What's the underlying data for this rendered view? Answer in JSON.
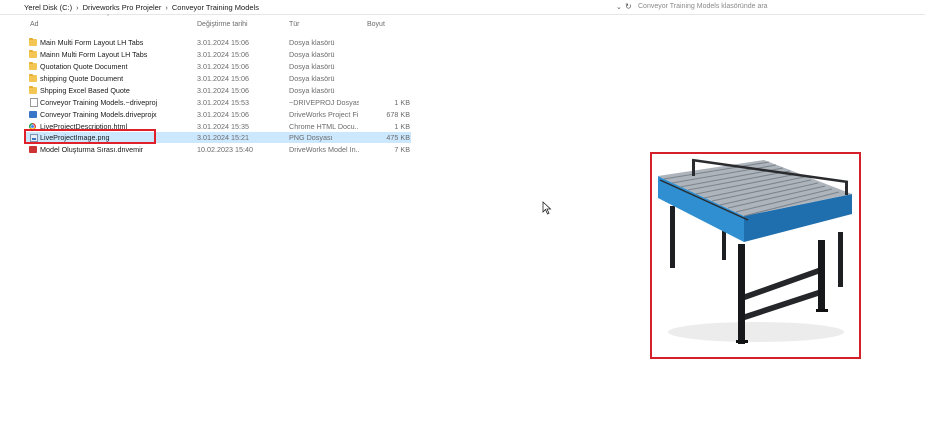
{
  "address_bar": {
    "breadcrumbs": [
      "Yerel Disk (C:)",
      "Driveworks Pro Projeler",
      "Conveyor Training Models"
    ],
    "separator": "›",
    "search_placeholder": "Conveyor Training Models klasöründe ara"
  },
  "columns": {
    "name": "Ad",
    "date": "Değiştirme tarihi",
    "type": "Tür",
    "size": "Boyut"
  },
  "files": [
    {
      "name": "Main Multi Form Layout LH Tabs",
      "date": "3.01.2024 15:06",
      "type": "Dosya klasörü",
      "size": "",
      "icon": "folder-icon"
    },
    {
      "name": "Mainn Multi Form Layout LH Tabs",
      "date": "3.01.2024 15:06",
      "type": "Dosya klasörü",
      "size": "",
      "icon": "folder-icon"
    },
    {
      "name": "Quotation Quote Document",
      "date": "3.01.2024 15:06",
      "type": "Dosya klasörü",
      "size": "",
      "icon": "folder-icon"
    },
    {
      "name": "shipping Quote Document",
      "date": "3.01.2024 15:06",
      "type": "Dosya klasörü",
      "size": "",
      "icon": "folder-icon"
    },
    {
      "name": "Shpping Excel Based Quote",
      "date": "3.01.2024 15:06",
      "type": "Dosya klasörü",
      "size": "",
      "icon": "folder-icon"
    },
    {
      "name": "Conveyor Training Models.~driveproj",
      "date": "3.01.2024 15:53",
      "type": "~DRIVEPROJ Dosyası",
      "size": "1 KB",
      "icon": "file-icon"
    },
    {
      "name": "Conveyor Training Models.driveprojx",
      "date": "3.01.2024 15:06",
      "type": "DriveWorks Project Fi...",
      "size": "678 KB",
      "icon": "driveworks-project-icon"
    },
    {
      "name": "LiveProjectDescription.html",
      "date": "3.01.2024 15:35",
      "type": "Chrome HTML Docu...",
      "size": "1 KB",
      "icon": "chrome-html-icon"
    },
    {
      "name": "LiveProjectImage.png",
      "date": "3.01.2024 15:21",
      "type": "PNG Dosyası",
      "size": "475 KB",
      "icon": "png-file-icon",
      "selected": true
    },
    {
      "name": "Model Oluşturma Sırası.dnvemir",
      "date": "10.02.2023 15:40",
      "type": "DriveWorks Model In...",
      "size": "7 KB",
      "icon": "driveworks-model-icon"
    }
  ],
  "colors": {
    "selection": "#cce8ff",
    "highlight_border": "#e0202a",
    "preview_border": "#d4202a",
    "conveyor_frame": "#2f8fd0"
  }
}
